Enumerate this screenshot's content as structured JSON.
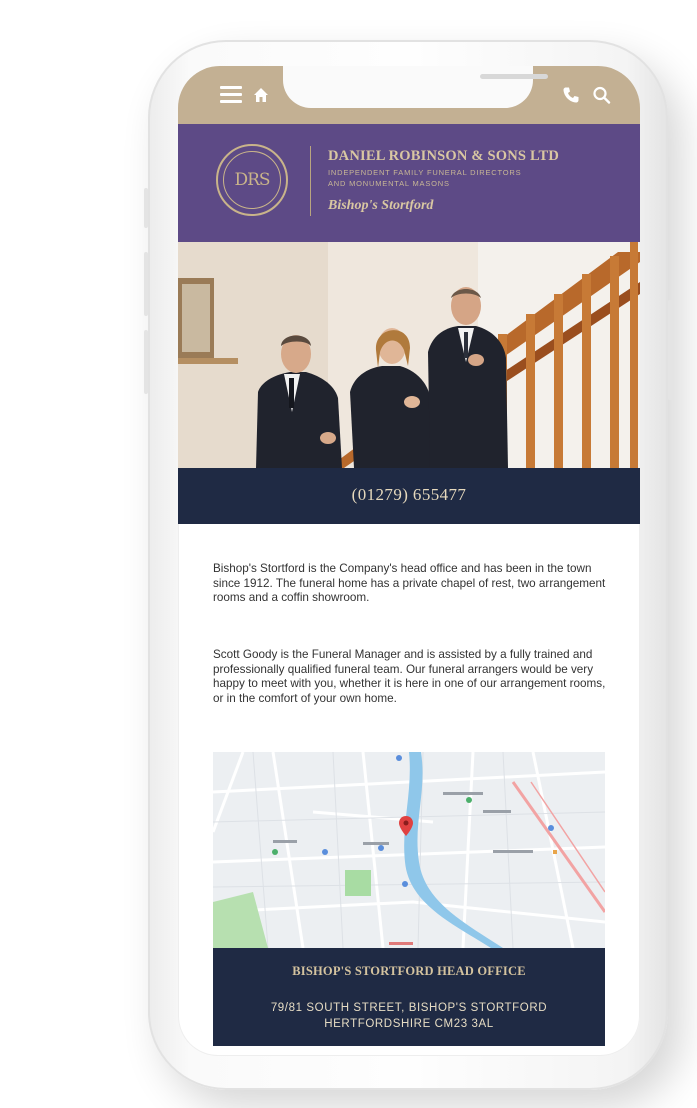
{
  "company": {
    "name": "DANIEL ROBINSON & SONS LTD",
    "tagline_line1": "INDEPENDENT FAMILY FUNERAL DIRECTORS",
    "tagline_line2": "AND MONUMENTAL MASONS",
    "branch": "Bishop's Stortford",
    "logo_monogram": "DRS"
  },
  "nav": {
    "icons": [
      "menu-icon",
      "home-icon",
      "phone-icon",
      "search-icon"
    ]
  },
  "contact": {
    "phone": "(01279) 655477"
  },
  "content": {
    "paragraph1": "Bishop's Stortford is the Company's head office and has been in the town since 1912. The funeral home has a private chapel of rest, two arrangement rooms and a coffin showroom.",
    "paragraph2": "Scott Goody is the Funeral Manager and is assisted by a fully trained and professionally qualified funeral team. Our funeral arrangers would be very happy to meet with you, whether it is here in one of our arrangement rooms, or in the comfort of your own home."
  },
  "office": {
    "title": "BISHOP'S STORTFORD HEAD OFFICE",
    "address_line1": "79/81 SOUTH STREET, BISHOP'S STORTFORD",
    "address_line2": "HERTFORDSHIRE CM23 3AL"
  },
  "colors": {
    "status_bar": "#c3b093",
    "brand_purple": "#5d4a86",
    "navy": "#1f2a44",
    "gold": "#d9c7a2"
  }
}
